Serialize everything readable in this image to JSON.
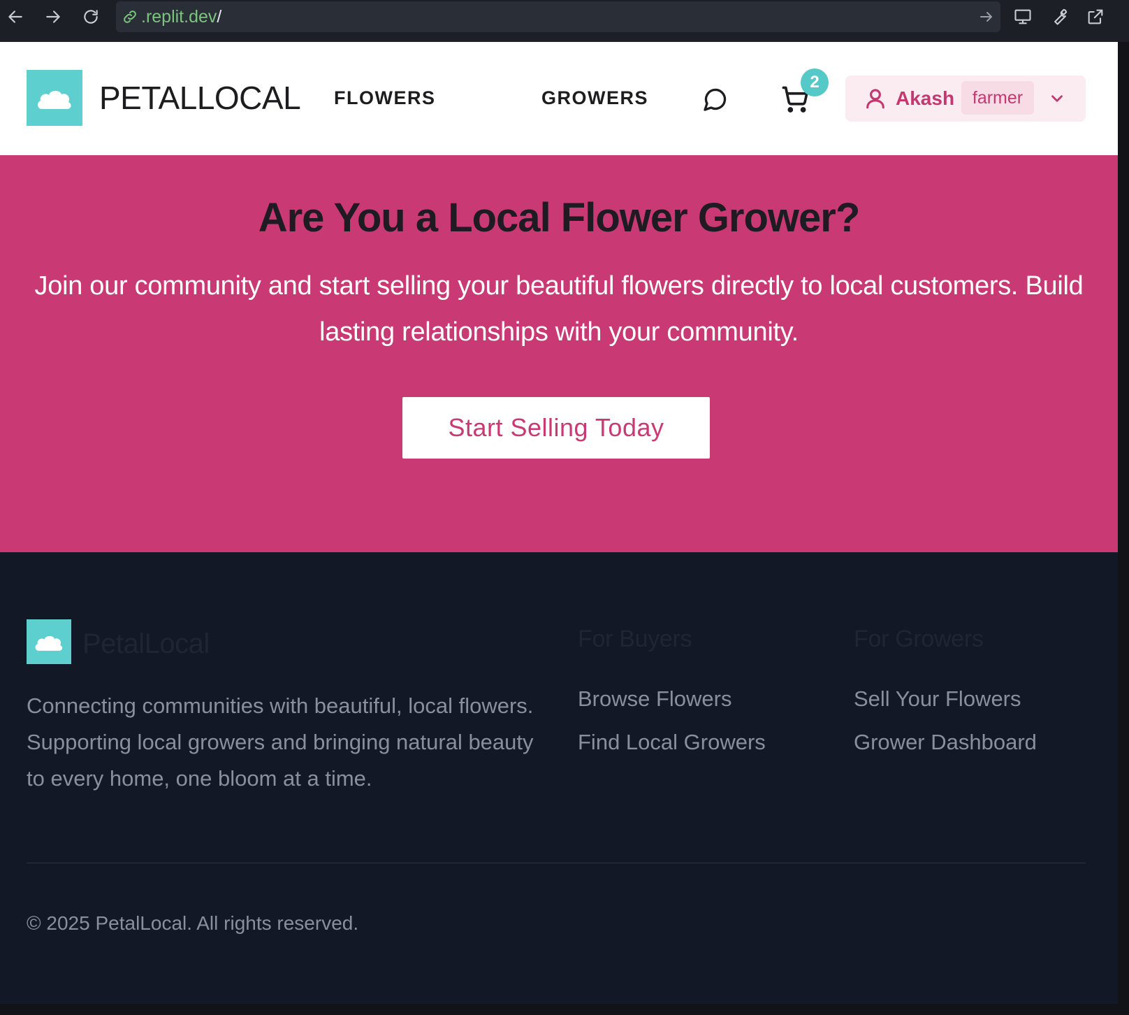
{
  "browser": {
    "url_domain": ".replit.dev",
    "url_path": "/",
    "icons": [
      "back-arrow-icon",
      "forward-arrow-icon",
      "reload-icon",
      "link-icon",
      "go-arrow-icon",
      "monitor-icon",
      "wrench-icon",
      "external-link-icon"
    ]
  },
  "header": {
    "brand": "PETALLOCAL",
    "nav": {
      "flowers": "FLOWERS",
      "growers": "GROWERS"
    },
    "cart_count": "2",
    "user": {
      "name": "Akash",
      "role": "farmer"
    }
  },
  "cta": {
    "title": "Are You a Local Flower Grower?",
    "text": "Join our community and start selling your beautiful flowers directly to local customers. Build lasting relationships with your community.",
    "button": "Start Selling Today"
  },
  "footer": {
    "brand": "PetalLocal",
    "description": "Connecting communities with beautiful, local flowers. Supporting local growers and bringing natural beauty to every home, one bloom at a time.",
    "buyers": {
      "heading": "For Buyers",
      "links": [
        "Browse Flowers",
        "Find Local Growers"
      ]
    },
    "growers": {
      "heading": "For Growers",
      "links": [
        "Sell Your Flowers",
        "Grower Dashboard"
      ]
    },
    "copyright": "© 2025 PetalLocal. All rights reserved."
  },
  "colors": {
    "brand_teal": "#5ecfcf",
    "brand_pink": "#c93a74",
    "footer_bg": "#121826"
  }
}
